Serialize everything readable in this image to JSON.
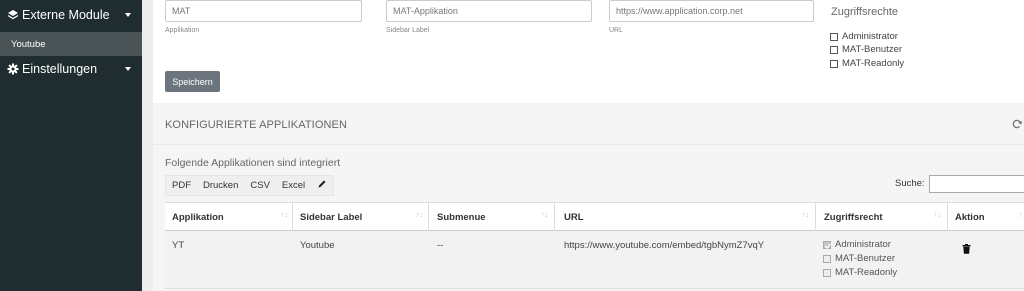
{
  "sidebar": {
    "items": [
      {
        "label": "Externe Module",
        "icon": "modules-icon"
      },
      {
        "label": "Einstellungen",
        "icon": "gear-icon"
      }
    ],
    "sub_items": [
      {
        "label": "Youtube"
      }
    ]
  },
  "form": {
    "applikation": {
      "value": "MAT",
      "label": "Applikation"
    },
    "sidebar_label": {
      "value": "MAT-Applikation",
      "label": "Sidebar Label"
    },
    "url": {
      "value": "https://www.application.corp.net",
      "label": "URL"
    },
    "zugriffsrechte": {
      "title": "Zugriffsrechte",
      "options": [
        "Administrator",
        "MAT-Benutzer",
        "MAT-Readonly"
      ]
    },
    "save_label": "Speichern"
  },
  "section": {
    "title": "KONFIGURIERTE APPLIKATIONEN",
    "refresh_icon": "refresh-icon",
    "subtitle": "Folgende Applikationen sind integriert",
    "export_buttons": [
      "PDF",
      "Drucken",
      "CSV",
      "Excel"
    ],
    "edit_icon": "pencil-icon",
    "search_label": "Suche:"
  },
  "table": {
    "columns": [
      "Applikation",
      "Sidebar Label",
      "Submenue",
      "URL",
      "Zugriffsrecht",
      "Aktion"
    ],
    "rows": [
      {
        "applikation": "YT",
        "sidebar_label": "Youtube",
        "submenue": "--",
        "url": "https://www.youtube.com/embed/tgbNymZ7vqY",
        "zugriffsrecht": [
          {
            "label": "Administrator",
            "checked": true
          },
          {
            "label": "MAT-Benutzer",
            "checked": false
          },
          {
            "label": "MAT-Readonly",
            "checked": false
          }
        ],
        "action_icon": "trash-icon"
      }
    ]
  },
  "colors": {
    "sidebar_bg": "#1f2d30",
    "sidebar_active": "#4a5456",
    "save_button": "#6c757d"
  }
}
